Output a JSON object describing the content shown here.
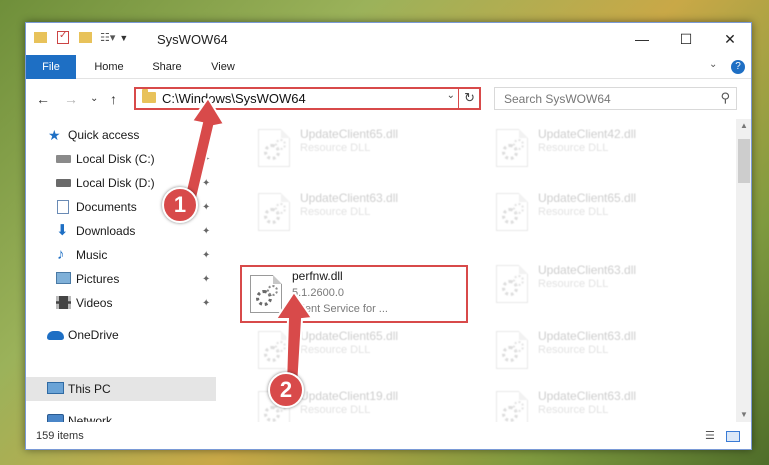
{
  "window": {
    "title": "SysWOW64",
    "controls": {
      "minimize": "—",
      "maximize": "☐",
      "close": "✕"
    }
  },
  "ribbon": {
    "tabs": [
      "File",
      "Home",
      "Share",
      "View"
    ],
    "expand_glyph": "⌄",
    "help_glyph": "?"
  },
  "nav": {
    "back": "←",
    "forward": "→",
    "recent": "⌄",
    "up": "↑",
    "address": "C:\\Windows\\SysWOW64",
    "address_dropdown": "⌄",
    "refresh": "↻",
    "search_placeholder": "Search SysWOW64",
    "search_glyph": "⚲"
  },
  "sidebar": {
    "items": [
      {
        "label": "Quick access",
        "icon": "star-icon",
        "pinned": false
      },
      {
        "label": "Local Disk (C:)",
        "icon": "drive-icon",
        "pinned": true
      },
      {
        "label": "Local Disk (D:)",
        "icon": "drive-icon",
        "pinned": true
      },
      {
        "label": "Documents",
        "icon": "documents-icon",
        "pinned": true
      },
      {
        "label": "Downloads",
        "icon": "downloads-icon",
        "pinned": true
      },
      {
        "label": "Music",
        "icon": "music-icon",
        "pinned": true
      },
      {
        "label": "Pictures",
        "icon": "pictures-icon",
        "pinned": true
      },
      {
        "label": "Videos",
        "icon": "videos-icon",
        "pinned": true
      },
      {
        "label": "OneDrive",
        "icon": "onedrive-icon",
        "pinned": false
      },
      {
        "label": "This PC",
        "icon": "computer-icon",
        "pinned": false
      },
      {
        "label": "Network",
        "icon": "network-icon",
        "pinned": false
      }
    ],
    "pin_glyph": "📌"
  },
  "files": {
    "left_column": [
      {
        "name": "UpdateClient65.dll",
        "type": "Resource DLL"
      },
      {
        "name": "UpdateClient63.dll",
        "type": "Resource DLL"
      },
      {
        "name": "perfnw.dll",
        "version": "5.1.2600.0",
        "description": "Client Service for ..."
      },
      {
        "name": "UpdateClient65.dll",
        "type": "Resource DLL"
      },
      {
        "name": "UpdateClient19.dll",
        "type": "Resource DLL"
      }
    ],
    "right_column": [
      {
        "name": "UpdateClient42.dll",
        "type": "Resource DLL"
      },
      {
        "name": "UpdateClient65.dll",
        "type": "Resource DLL"
      },
      {
        "name": "UpdateClient63.dll",
        "type": "Resource DLL"
      },
      {
        "name": "UpdateClient63.dll",
        "type": "Resource DLL"
      },
      {
        "name": "UpdateClient63.dll",
        "type": "Resource DLL"
      }
    ]
  },
  "status": {
    "item_count": "159 items"
  },
  "annotations": {
    "step1": "1",
    "step2": "2",
    "color": "#d84a4a"
  },
  "colors": {
    "accent": "#1e6fc4",
    "highlight": "#d84a4a",
    "folder": "#e8c25a"
  }
}
